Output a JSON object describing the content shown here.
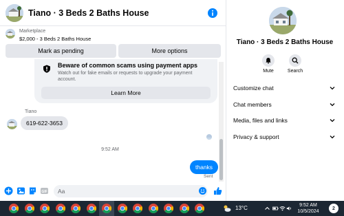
{
  "chat": {
    "title": "Tiano · 3 Beds 2 Baths House",
    "marketplace": {
      "label": "Marketplace",
      "listing": "$2,000 - 3 Beds 2 Baths House",
      "mark_pending": "Mark as pending",
      "more_options": "More options"
    },
    "warning": {
      "title": "Beware of common scams using payment apps",
      "description": "Watch out for fake emails or requests to upgrade your payment account.",
      "button": "Learn More"
    },
    "messages": {
      "sender": "Tiano",
      "incoming": "619-622-3653",
      "timestamp": "9:52 AM",
      "outgoing": "thanks",
      "status": "Sent"
    },
    "composer": {
      "placeholder": "Aa"
    }
  },
  "sidebar": {
    "title": "Tiano · 3 Beds 2 Baths House",
    "actions": [
      {
        "label": "Mute",
        "icon": "bell-icon"
      },
      {
        "label": "Search",
        "icon": "search-icon"
      }
    ],
    "sections": [
      {
        "label": "Customize chat"
      },
      {
        "label": "Chat members"
      },
      {
        "label": "Media, files and links"
      },
      {
        "label": "Privacy & support"
      }
    ]
  },
  "taskbar": {
    "temperature": "13°C",
    "time": "9:52 AM",
    "date": "10/5/2024",
    "notifications": "2",
    "app_icon": "chrome-icon",
    "app_count": 13
  },
  "colors": {
    "accent": "#0084ff",
    "bubble_gray": "#e4e6eb",
    "taskbar": "#1c2733"
  }
}
